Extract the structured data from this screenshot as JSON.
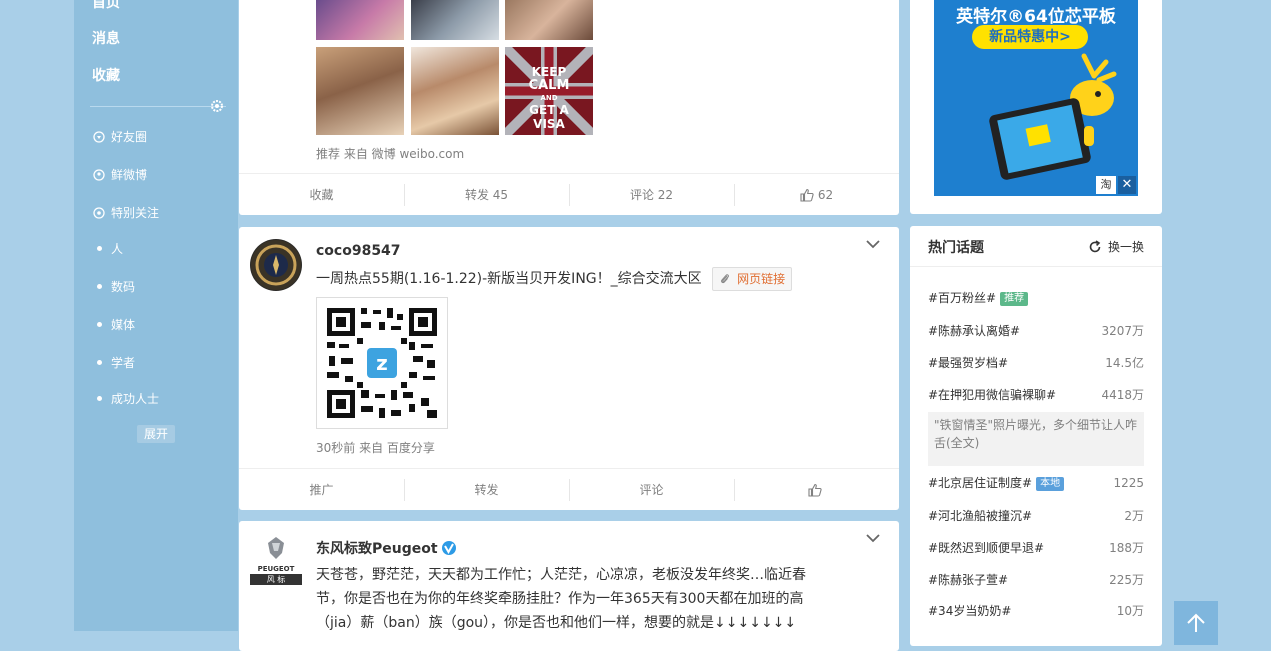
{
  "nav": {
    "main": [
      "首页",
      "消息",
      "收藏"
    ],
    "groups": [
      "好友圈",
      "鲜微博",
      "特别关注",
      "人",
      "数码",
      "媒体",
      "学者",
      "成功人士"
    ],
    "expand": "展开"
  },
  "feed": {
    "post1": {
      "photo_texts": [
        "KEEP",
        "CALM",
        "AND",
        "GET A",
        "VISA"
      ],
      "source": "推荐 来自 微博 weibo.com",
      "actions": {
        "collect": "收藏",
        "repost": "转发 45",
        "comment": "评论 22",
        "like": "62"
      }
    },
    "post2": {
      "user": "coco98547",
      "text": "一周热点55期(1.16-1.22)-新版当贝开发ING！_综合交流大区",
      "link_label": "网页链接",
      "source": "30秒前 来自 百度分享",
      "actions": {
        "promote": "推广",
        "repost": "转发",
        "comment": "评论"
      }
    },
    "post3": {
      "user": "东风标致Peugeot",
      "logo_text": "PEUGEOT",
      "logo_subtext": "风 标",
      "text_lines": [
        "天苍苍，野茫茫，天天都为工作忙；人茫茫，心凉凉，老板没发年终奖…临近春",
        "节，你是否也在为你的年终奖牵肠挂肚？作为一年365天有300天都在加班的高",
        "（jia）薪（ban）族（gou），你是否也和他们一样，想要的就是↓↓↓↓↓↓↓"
      ]
    }
  },
  "ad": {
    "headline": "英特尔®64位芯平板",
    "button": "新品特惠中>",
    "corner": "淘"
  },
  "hot_topics": {
    "title": "热门话题",
    "refresh": "换一换",
    "items": [
      {
        "name": "#百万粉丝#",
        "badge": "推荐",
        "badge_color": "#5cb88a",
        "count": ""
      },
      {
        "name": "#陈赫承认离婚#",
        "count": "3207万"
      },
      {
        "name": "#最强贺岁档#",
        "count": "14.5亿"
      },
      {
        "name": "#在押犯用微信骗裸聊#",
        "count": "4418万"
      },
      {
        "name": "#北京居住证制度#",
        "badge": "本地",
        "badge_color": "#5aa0dc",
        "count": "1225"
      },
      {
        "name": "#河北渔船被撞沉#",
        "count": "2万"
      },
      {
        "name": "#既然迟到顺便早退#",
        "count": "188万"
      },
      {
        "name": "#陈赫张子萱#",
        "count": "225万"
      },
      {
        "name": "#34岁当奶奶#",
        "count": "10万"
      }
    ],
    "snippet": "\"铁窗情圣\"照片曝光，多个细节让人咋舌(全文)"
  },
  "colors": {
    "page_bg": "#a9cfe8",
    "nav_bg": "#8fbfdd",
    "accent_orange": "#e06e32"
  }
}
